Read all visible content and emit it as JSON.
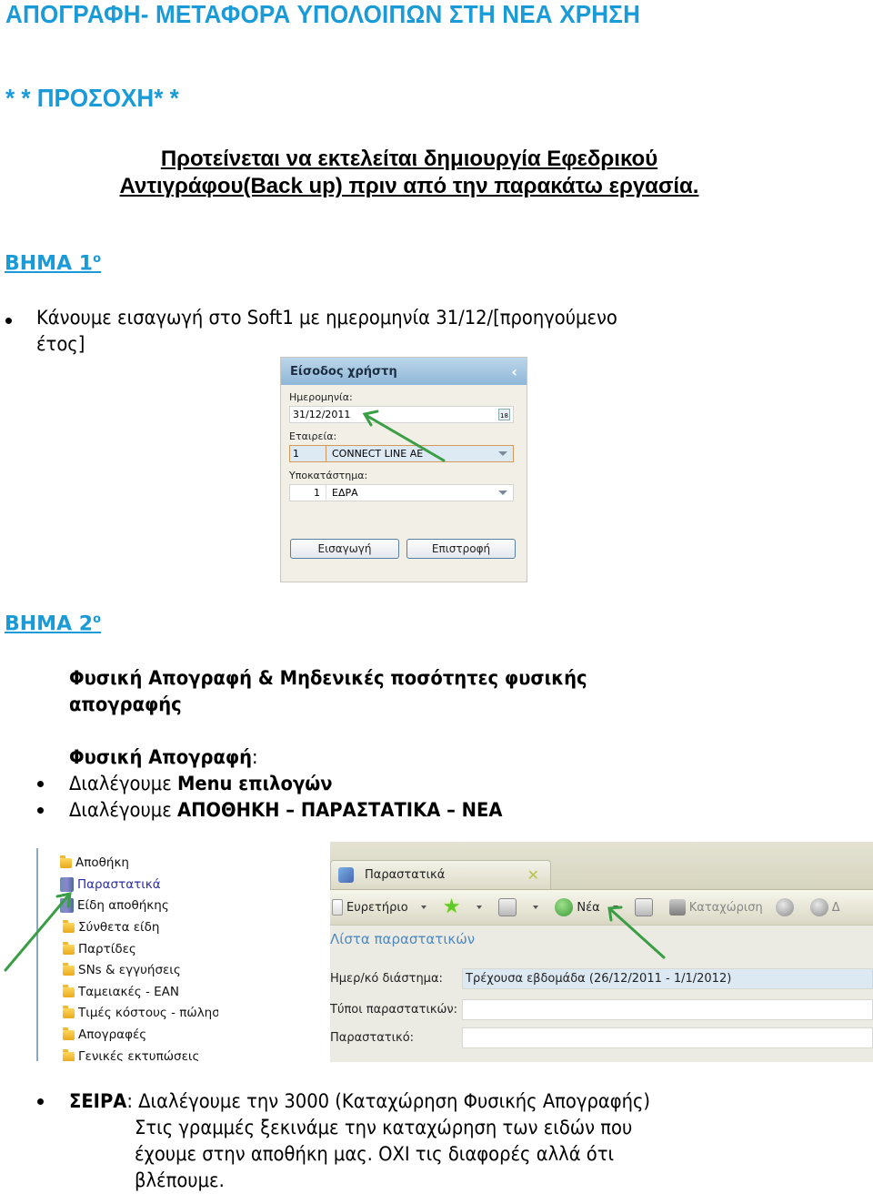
{
  "document": {
    "title": "ΑΠΟΓΡΑΦΗ- ΜΕΤΑΦΟΡΑ ΥΠΟΛΟΙΠΩΝ ΣΤΗ ΝΕΑ ΧΡΗΣΗ",
    "caution": "* * ΠΡΟΣΟΧΗ* *",
    "backup_note": {
      "line1": "Προτείνεται να εκτελείται δημιουργία Εφεδρικού",
      "line2": "Αντιγράφου(Back up) πριν από την παρακάτω εργασία."
    },
    "step1": {
      "heading": "ΒΗΜΑ 1",
      "ordinal": "ο",
      "bullet_line1": "Κάνουμε εισαγωγή στο Soft1 με ημερομηνία 31/12/[προηγούμενο",
      "bullet_line2": "έτος]"
    },
    "step2": {
      "heading": "ΒΗΜΑ 2",
      "ordinal": "ο",
      "subtitle_line1": "Φυσική Απογραφή & Μηδενικές ποσότητες φυσικής",
      "subtitle_line2": "απογραφής",
      "section_label": "Φυσική Απογραφή",
      "section_colon": ":",
      "bullets": [
        {
          "prefix": "Διαλέγουμε ",
          "bold": "Menu επιλογών"
        },
        {
          "prefix": "Διαλέγουμε ",
          "bold": "ΑΠΟΘΗΚΗ – ΠΑΡΑΣΤΑΤΙΚΑ – ΝΕΑ"
        }
      ],
      "series_bullet": {
        "bold": "ΣΕΙΡΑ",
        "line1_rest": ": Διαλέγουμε την 3000 (Καταχώρηση Φυσικής Απογραφής)",
        "line2": "Στις γραμμές ξεκινάμε την καταχώρηση των ειδών που",
        "line3": "έχουμε στην αποθήκη μας. ΟΧΙ τις διαφορές αλλά ότι",
        "line4": "βλέπουμε."
      }
    }
  },
  "login_panel": {
    "header": "Είσοδος χρήστη",
    "collapse_icon": "‹",
    "date_label": "Ημερομηνία:",
    "date_value": "31/12/2011",
    "calendar_icon_text": "18",
    "company_label": "Εταιρεία:",
    "company_code": "1",
    "company_name": "CONNECT LINE AE",
    "branch_label": "Υποκατάστημα:",
    "branch_code": "1",
    "branch_name": "ΕΔΡΑ",
    "login_button": "Εισαγωγή",
    "back_button": "Επιστροφή"
  },
  "menu_tree": {
    "parent": "Αποθήκη",
    "items": [
      {
        "label": "Παραστατικά",
        "icon": "books",
        "active": true
      },
      {
        "label": "Είδη αποθήκης",
        "icon": "books",
        "active": false
      },
      {
        "label": "Σύνθετα είδη",
        "icon": "folder",
        "active": false
      },
      {
        "label": "Παρτίδες",
        "icon": "folder",
        "active": false
      },
      {
        "label": "SNs & εγγυήσεις",
        "icon": "folder",
        "active": false
      },
      {
        "label": "Ταμειακές - EAN",
        "icon": "folder",
        "active": false
      },
      {
        "label": "Τιμές κόστους - πώλησης",
        "icon": "folder",
        "active": false
      },
      {
        "label": "Απογραφές",
        "icon": "folder",
        "active": false
      },
      {
        "label": "Γενικές εκτυπώσεις",
        "icon": "folder",
        "active": false
      }
    ]
  },
  "documents_window": {
    "tab_label": "Παραστατικά",
    "tab_close": "✕",
    "toolbar": {
      "index_label": "Ευρετήριο",
      "new_label": "Νέα",
      "save_label": "Καταχώριση",
      "delete_label_partial": "Δ"
    },
    "list_title": "Λίστα παραστατικών",
    "filters": [
      {
        "label": "Ημερ/κό διάστημα:",
        "value": "Τρέχουσα εβδομάδα (26/12/2011 - 1/1/2012)"
      },
      {
        "label": "Τύποι παραστατικών:",
        "value": ""
      },
      {
        "label": "Παραστατικό:",
        "value": ""
      }
    ]
  },
  "colors": {
    "heading_blue": "#1a9bd7",
    "annotation_arrow": "#3a9e45"
  }
}
